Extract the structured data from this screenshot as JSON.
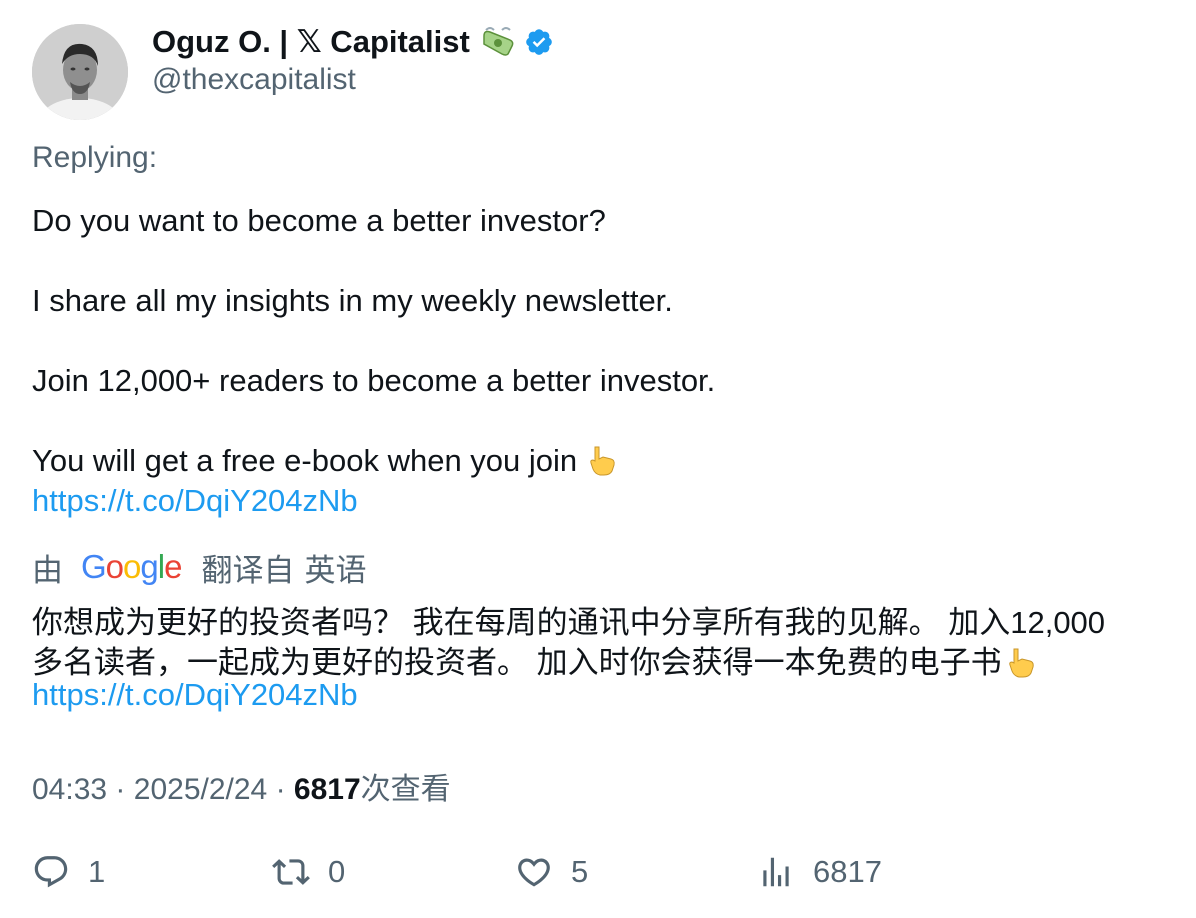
{
  "author": {
    "display_name": "Oguz O. | 𝕏 Capitalist",
    "handle": "@thexcapitalist",
    "emoji_icon": "money-with-wings-icon",
    "verified_color": "#1d9bf0"
  },
  "replying_label": "Replying:",
  "tweet": {
    "line1": "Do you want to become a better investor?",
    "line2": "I share all my insights in my weekly newsletter.",
    "line3": "Join 12,000+ readers to become a better investor.",
    "line4": "You will get a free e-book when you join",
    "link": "https://t.co/DqiY204zNb"
  },
  "translation": {
    "by_label": "由",
    "google_letters": [
      "G",
      "o",
      "o",
      "g",
      "l",
      "e"
    ],
    "translated_from": "翻译自",
    "language": "英语",
    "line1": "你想成为更好的投资者吗？ 我在每周的通讯中分享所有我的见解。 加入12,000",
    "line2": "多名读者，一起成为更好的投资者。 加入时你会获得一本免费的电子书",
    "link": "https://t.co/DqiY204zNb"
  },
  "meta": {
    "time": "04:33",
    "separator": "·",
    "date": "2025/2/24",
    "views_count": "6817",
    "views_label": "次查看"
  },
  "actions": {
    "reply_count": "1",
    "retweet_count": "0",
    "like_count": "5",
    "views_count": "6817"
  },
  "colors": {
    "text_primary": "#0f1419",
    "text_secondary": "#536471",
    "link": "#1d9bf0"
  }
}
